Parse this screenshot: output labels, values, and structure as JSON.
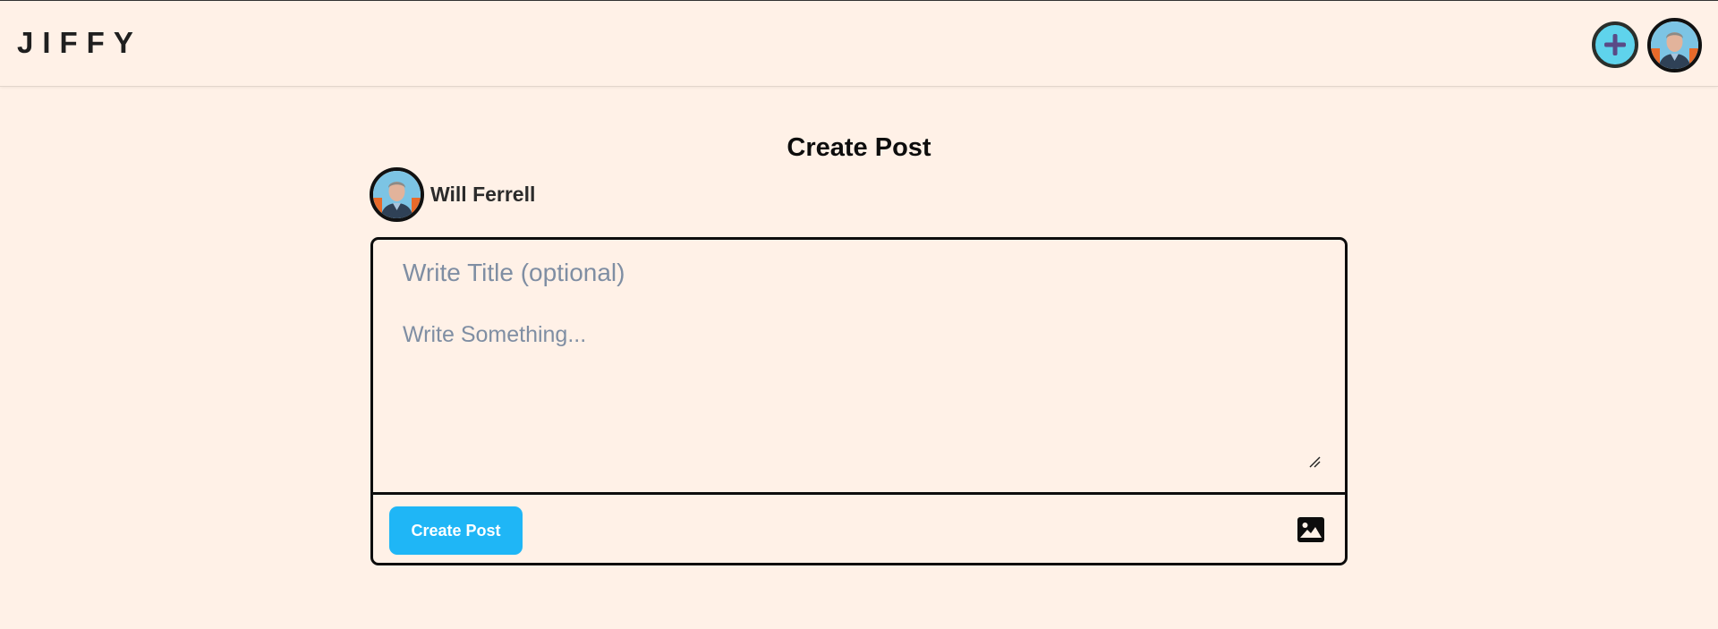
{
  "header": {
    "logo": "JIFFY",
    "add_icon": "plus-icon",
    "avatar_icon": "user-avatar"
  },
  "main": {
    "title": "Create Post",
    "author": {
      "name": "Will Ferrell"
    },
    "form": {
      "title_placeholder": "Write Title (optional)",
      "title_value": "",
      "body_placeholder": "Write Something...",
      "body_value": "",
      "submit_label": "Create Post",
      "image_icon": "image-icon"
    }
  },
  "colors": {
    "background": "#fff1e7",
    "accent": "#1fb6f6",
    "add_button": "#5fd3ec",
    "border": "#0d0d0d",
    "placeholder": "#7f8ea3"
  }
}
